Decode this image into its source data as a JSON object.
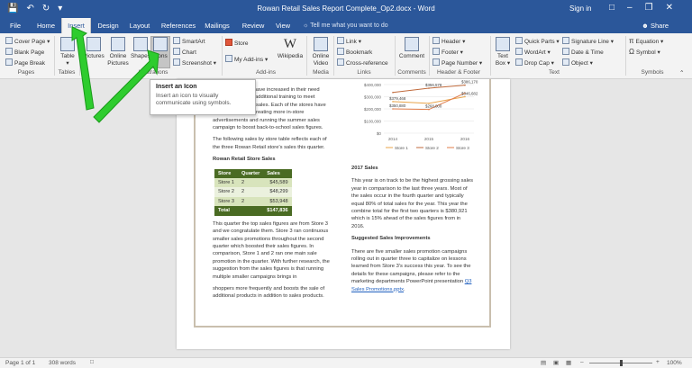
{
  "titlebar": {
    "title": "Rowan Retail Sales Report Complete_Op2.docx - Word",
    "signin": "Sign in",
    "restore_icon": "restore-icon",
    "minimize_icon": "minimize-icon",
    "close_icon": "close-icon"
  },
  "tabs": [
    "File",
    "Home",
    "Insert",
    "Design",
    "Layout",
    "References",
    "Mailings",
    "Review",
    "View"
  ],
  "active_tab": "Insert",
  "tell_me": "Tell me what you want to do",
  "share": "Share",
  "ribbon": {
    "pages": {
      "label": "Pages",
      "cover": "Cover Page",
      "blank": "Blank Page",
      "break": "Page Break"
    },
    "tables": {
      "label": "Tables",
      "table": "Table"
    },
    "illustrations": {
      "label": "Illustrations",
      "pictures": "Pictures",
      "online": "Online",
      "pictures2": "Pictures",
      "shapes": "Shapes",
      "icons": "Icons",
      "smartart": "SmartArt",
      "chart": "Chart",
      "screenshot": "Screenshot"
    },
    "addins": {
      "label": "Add-ins",
      "store": "Store",
      "my": "My Add-ins",
      "wikipedia": "Wikipedia"
    },
    "media": {
      "label": "Media",
      "video1": "Online",
      "video2": "Video"
    },
    "links": {
      "label": "Links",
      "link": "Link",
      "bookmark": "Bookmark",
      "crossref": "Cross-reference"
    },
    "comments": {
      "label": "Comments",
      "comment": "Comment"
    },
    "header_footer": {
      "label": "Header & Footer",
      "header": "Header",
      "footer": "Footer",
      "page_number": "Page Number"
    },
    "text": {
      "label": "Text",
      "textbox1": "Text",
      "textbox2": "Box",
      "quick": "Quick Parts",
      "wordart": "WordArt",
      "dropcap": "Drop Cap",
      "sigline": "Signature Line",
      "datetime": "Date & Time",
      "object": "Object"
    },
    "symbols": {
      "label": "Symbols",
      "equation": "Equation",
      "symbol": "Symbol"
    }
  },
  "tooltip": {
    "title": "Insert an Icon",
    "desc": "Insert an icon to visually communicate using symbols."
  },
  "doc": {
    "left1": "The sales figures have increased in their need",
    "left2": "for the region and additional training to meet",
    "left3": "demand for all the sales. Each of the stores have",
    "left4": "been tasked with creating more in-store",
    "left5": "advertisements and running the summer sales",
    "left6": "campaign to boost back-to-school sales figures.",
    "para2": "The following sales by store table reflects each of the three Rowan Retail store's sales this quarter.",
    "table_title": "Rowan Retail Store Sales",
    "table": {
      "headers": [
        "Store",
        "Quarter",
        "Sales"
      ],
      "rows": [
        [
          "Store 1",
          "2",
          "$45,589"
        ],
        [
          "Store 2",
          "2",
          "$48,299"
        ],
        [
          "Store 3",
          "2",
          "$53,948"
        ]
      ],
      "total": [
        "Total",
        "",
        "$147,836"
      ]
    },
    "para3": "This quarter the top sales figures are from Store 3 and we congratulate them. Store 3 ran continuous smaller sales promotions throughout the second quarter which boosted their sales figures. In comparison, Store 1 and 2 ran one main sale promotion in the quarter. With further research, the suggestion from the sales figures is that running multiple smaller campaigns brings in",
    "para4": "shoppers more frequently and boosts the sale of additional products in addition to sales products.",
    "heading2017": "2017 Sales",
    "para2017": "This year is on track to be the highest grossing sales year in comparison to the last three years. Most of the sales occur in the fourth quarter and typically equal 80% of total sales for the year. This year the combine total for the first two quarters is $380,921 which is 15% ahead of the sales figures from in 2016.",
    "heading_suggested": "Suggested Sales Improvements",
    "para_suggested": "There are five smaller sales promotion campaigns rolling out in quarter three to capitalize on lessons learned from Store 3's success this year. To see the details for these campaigns, please refer to the marketing departments PowerPoint presentation",
    "link": "Q3 Sales Promotions.pptx"
  },
  "chart_data": {
    "type": "line",
    "x": [
      "2014",
      "2015",
      "2016"
    ],
    "ylim": [
      0,
      400000
    ],
    "yticks": [
      "$400,000",
      "$300,000",
      "$200,000",
      "$100,000",
      "$0"
    ],
    "series": [
      {
        "name": "Store 1",
        "color": "#e8a44a",
        "values": [
          260000,
          245000,
          300000
        ]
      },
      {
        "name": "Store 2",
        "color": "#c06a3c",
        "values": [
          335000,
          370000,
          395000
        ]
      },
      {
        "name": "Store 3",
        "color": "#e07c4a",
        "values": [
          200000,
          195000,
          330000
        ]
      }
    ],
    "data_labels": [
      "$379,468",
      "$356,578",
      "$386,170",
      "$346,682",
      "$350,880",
      "$268,000"
    ],
    "legend_position": "bottom"
  },
  "status": {
    "page": "Page 1 of 1",
    "words": "308 words",
    "zoom": "100%"
  }
}
